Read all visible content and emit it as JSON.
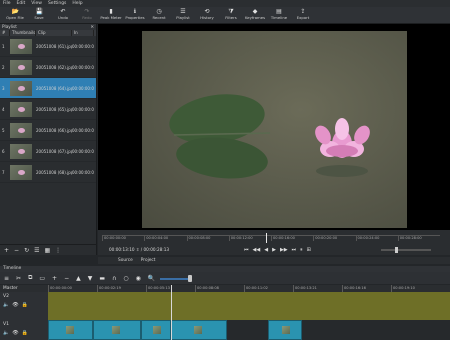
{
  "menu": [
    "File",
    "Edit",
    "View",
    "Settings",
    "Help"
  ],
  "toolbar": [
    {
      "label": "Open File",
      "icon": "folder-open-icon",
      "glyph": "📂",
      "enabled": true
    },
    {
      "label": "Save",
      "icon": "save-icon",
      "glyph": "💾",
      "enabled": true
    },
    {
      "label": "Undo",
      "icon": "undo-icon",
      "glyph": "↶",
      "enabled": true
    },
    {
      "label": "Redo",
      "icon": "redo-icon",
      "glyph": "↷",
      "enabled": false
    },
    {
      "label": "Peak Meter",
      "icon": "peak-meter-icon",
      "glyph": "▮",
      "enabled": true
    },
    {
      "label": "Properties",
      "icon": "properties-icon",
      "glyph": "ℹ",
      "enabled": true
    },
    {
      "label": "Recent",
      "icon": "recent-icon",
      "glyph": "◷",
      "enabled": true
    },
    {
      "label": "Playlist",
      "icon": "playlist-icon",
      "glyph": "☰",
      "enabled": true
    },
    {
      "label": "History",
      "icon": "history-icon",
      "glyph": "⟲",
      "enabled": true
    },
    {
      "label": "Filters",
      "icon": "filters-icon",
      "glyph": "⧩",
      "enabled": true
    },
    {
      "label": "Keyframes",
      "icon": "keyframes-icon",
      "glyph": "◆",
      "enabled": true
    },
    {
      "label": "Timeline",
      "icon": "timeline-icon",
      "glyph": "▤",
      "enabled": true
    },
    {
      "label": "Export",
      "icon": "export-icon",
      "glyph": "⇪",
      "enabled": true
    }
  ],
  "playlist": {
    "title": "Playlist",
    "columns": [
      "#",
      "Thumbnails",
      "Clip",
      "In"
    ],
    "rows": [
      {
        "num": "1",
        "clip": "20051008 (61).jpg",
        "dur": "00:00:00:0"
      },
      {
        "num": "2",
        "clip": "20051008 (62).jpg",
        "dur": "00:00:00:0"
      },
      {
        "num": "3",
        "clip": "20051008 (64).jpg",
        "dur": "00:00:00:0"
      },
      {
        "num": "4",
        "clip": "20051008 (65).jpg",
        "dur": "00:00:00:0"
      },
      {
        "num": "5",
        "clip": "20051008 (66).jpg",
        "dur": "00:00:00:0"
      },
      {
        "num": "6",
        "clip": "20051008 (67).jpg",
        "dur": "00:00:00:0"
      },
      {
        "num": "7",
        "clip": "20051008 (68).jpg",
        "dur": "00:00:00:0"
      }
    ],
    "selected_index": 2,
    "tool_glyphs": [
      "+",
      "−",
      "↻",
      "☰",
      "▦",
      "⋮"
    ]
  },
  "viewer": {
    "ruler": [
      "00:00:00:00",
      "00:00:04:00",
      "00:00:08:00",
      "00:00:12:00",
      "00:00:16:00",
      "00:00:20:00",
      "00:00:24:00",
      "00:00:28:00"
    ],
    "timecode": "00:00:13:10",
    "duration": "/ 00:00:28:13",
    "controls": [
      "⏮",
      "◀◀",
      "◀",
      "▶",
      "▶▶",
      "⏭",
      "⏸",
      "⊞"
    ],
    "tabs": [
      "Source",
      "Project"
    ]
  },
  "timeline": {
    "title": "Timeline",
    "tool_glyphs": [
      "≡",
      "✂",
      "⧉",
      "▭",
      "+",
      "−",
      "▲",
      "▼",
      "▬",
      "∩",
      "○",
      "◉",
      "🔍"
    ],
    "master_label": "Master",
    "ruler": [
      "00:00:00:00",
      "00:00:02:19",
      "00:00:05:13",
      "00:00:08:08",
      "00:00:11:02",
      "00:00:13:21",
      "00:00:16:16",
      "00:00:19:10"
    ],
    "tracks": [
      {
        "name": "V2"
      },
      {
        "name": "V1"
      }
    ]
  },
  "colors": {
    "accent": "#2f7fb4",
    "track_v2": "#6e6f27",
    "clip": "#2a93b0"
  }
}
